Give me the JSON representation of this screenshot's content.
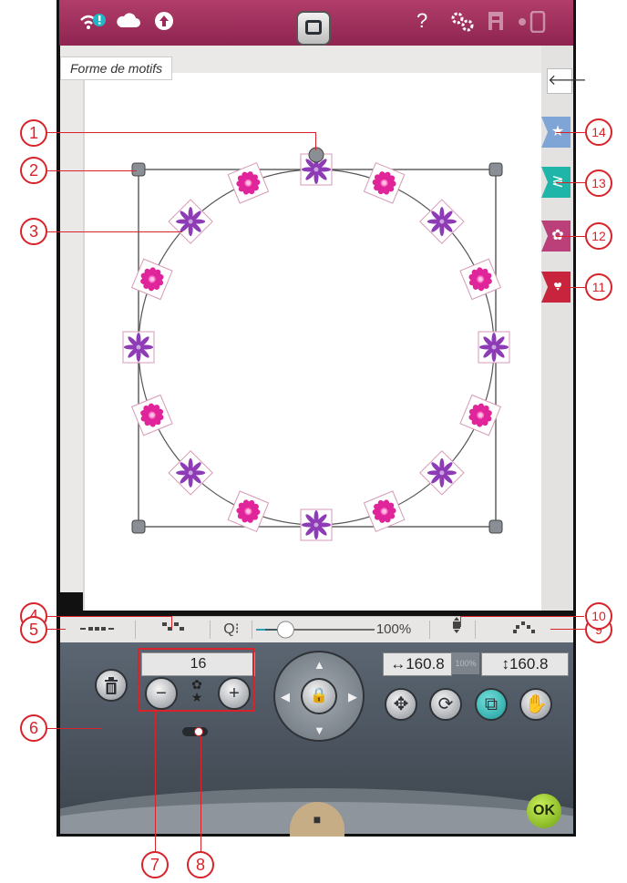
{
  "status_bar": {
    "wifi_icon": "wifi-alert-icon",
    "cloud_icon": "cloud-icon",
    "upload_icon": "upload-icon",
    "home_icon": "home-icon",
    "help_label": "?",
    "settings_icon": "gear-icon",
    "machine_icon": "machine-icon",
    "window_icon": "window-icon"
  },
  "view_tab": {
    "label": "Forme de motifs"
  },
  "right_tabs": [
    {
      "icon": "star-icon",
      "glyph": "★",
      "color": "#7fa4d6"
    },
    {
      "icon": "zigzag-stitch-icon",
      "glyph": "≷",
      "color": "#1fb5a9"
    },
    {
      "icon": "flower-icon",
      "glyph": "✿",
      "color": "#bb3f78"
    },
    {
      "icon": "heart-frame-icon",
      "glyph": "♥",
      "color": "#c9243d"
    }
  ],
  "toolbar": {
    "zoom_value": "100%",
    "zoom_level": 0.08
  },
  "shape_panel": {
    "count": "16"
  },
  "dimensions": {
    "width": "↔160.8",
    "proportion": "100%",
    "height": "↕160.8"
  },
  "buttons": {
    "ok": "OK"
  },
  "callouts": [
    "1",
    "2",
    "3",
    "4",
    "5",
    "6",
    "7",
    "8",
    "9",
    "10",
    "11",
    "12",
    "13",
    "14"
  ],
  "colors": {
    "accent": "#9d2a5c",
    "callout_red": "#d8232a",
    "motif_purple": "#8e3bb6",
    "motif_pink": "#e0249a"
  }
}
